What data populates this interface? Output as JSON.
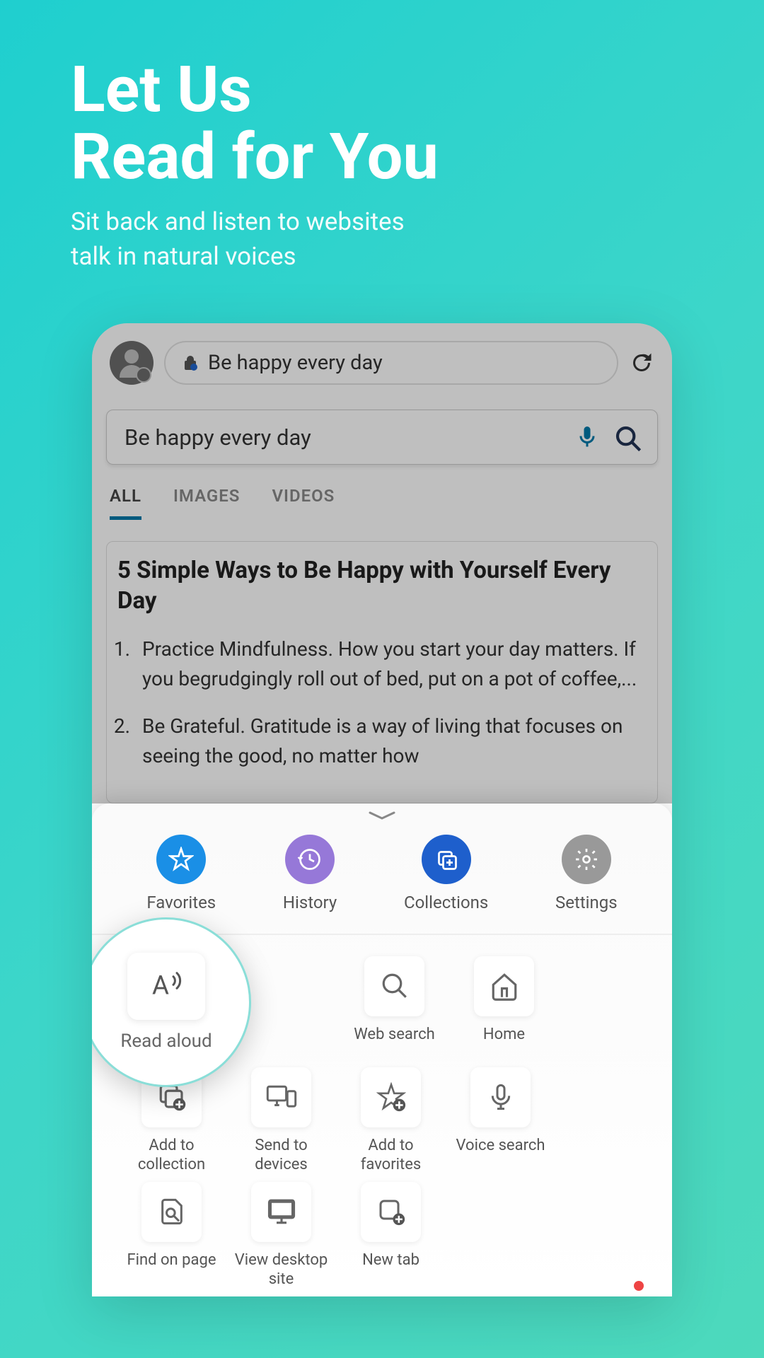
{
  "promo": {
    "title_line1": "Let Us",
    "title_line2": "Read for You",
    "subtitle_line1": "Sit back and listen to websites",
    "subtitle_line2": "talk in natural voices"
  },
  "browser": {
    "url_text": "Be happy every day",
    "search_text": "Be happy every day",
    "tabs": {
      "all": "ALL",
      "images": "IMAGES",
      "videos": "VIDEOS"
    },
    "article": {
      "title": "5 Simple Ways to Be Happy with Yourself Every Day",
      "item1": "Practice Mindfulness. How you start your day matters. If you begrudgingly roll out of bed, put on a pot of coffee,...",
      "item2": "Be Grateful. Gratitude is a way of living that focuses on seeing the good, no matter how"
    }
  },
  "sheet": {
    "actions": {
      "favorites": "Favorites",
      "history": "History",
      "collections": "Collections",
      "settings": "Settings"
    },
    "tools": {
      "read_aloud": "Read aloud",
      "web_search": "Web search",
      "home": "Home",
      "add_collection": "Add to collection",
      "send_devices": "Send to devices",
      "add_favorites": "Add to favorites",
      "voice_search": "Voice search",
      "find_page": "Find on page",
      "desktop_site": "View desktop site",
      "new_tab": "New tab"
    }
  }
}
